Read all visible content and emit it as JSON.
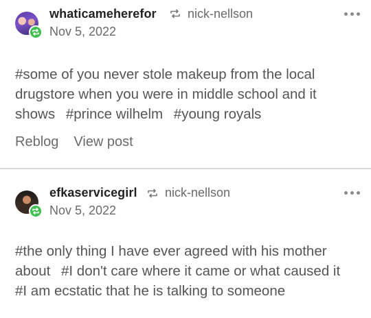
{
  "posts": [
    {
      "username": "whaticameherefor",
      "source": "nick-nellson",
      "date": "Nov 5, 2022",
      "tags": [
        "#some of you never stole makeup from the local drugstore when you were in middle school and it shows",
        "#prince wilhelm",
        "#young royals"
      ],
      "actions": {
        "reblog": "Reblog",
        "view_post": "View post"
      },
      "icons": {
        "avatar": "avatar-image",
        "badge": "reblog-badge-icon",
        "reblog": "reblog-icon",
        "more": "more-options-icon"
      }
    },
    {
      "username": "efkaservicegirl",
      "source": "nick-nellson",
      "date": "Nov 5, 2022",
      "tags": [
        "#the only thing I have ever agreed with his mother about",
        "#I don't care where it came or what caused it",
        "#I am ecstatic that he is talking to someone"
      ]
    }
  ],
  "colors": {
    "badge_green": "#3fbf4e",
    "muted_text": "#6a6a6a",
    "divider": "#d9d9d9"
  }
}
